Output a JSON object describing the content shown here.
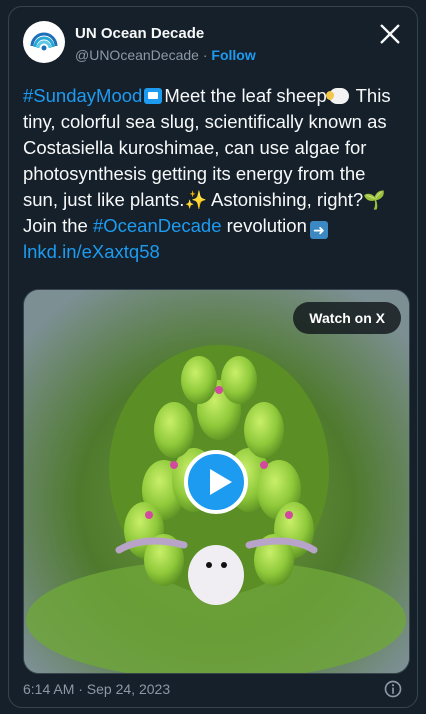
{
  "author": {
    "name": "UN Ocean Decade",
    "handle": "@UNOceanDecade",
    "separator": "·",
    "follow_label": "Follow"
  },
  "tweet": {
    "hashtag1": "#SundayMood",
    "part1": "Meet the leaf sheep",
    "part2": "This tiny, colorful sea slug, scientifically known as Costasiella kuroshimae, can use algae for photosynthesis getting its energy from the sun, just like plants.",
    "part3": "Astonishing, right?",
    "part4": "Join the",
    "hashtag2": "#OceanDecade",
    "part5": "revolution",
    "link": "lnkd.in/eXaxtq58"
  },
  "media": {
    "watch_label": "Watch on X"
  },
  "footer": {
    "timestamp": "6:14 AM · Sep 24, 2023"
  },
  "icons": {
    "x_logo": "x-logo-icon",
    "play": "play-icon",
    "info": "info-icon"
  },
  "colors": {
    "background": "#15202b",
    "accent": "#1d9bf0",
    "muted": "#8b98a5"
  }
}
